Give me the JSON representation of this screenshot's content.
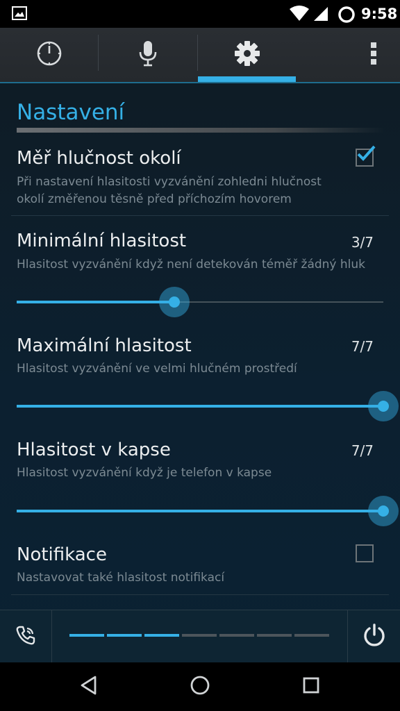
{
  "status_bar": {
    "time": "9:58"
  },
  "tabs": [
    {
      "name": "timer",
      "icon": "clock-icon",
      "selected": false
    },
    {
      "name": "mic",
      "icon": "microphone-icon",
      "selected": false
    },
    {
      "name": "settings",
      "icon": "gear-icon",
      "selected": true
    }
  ],
  "menu_icon": "overflow-menu-icon",
  "colors": {
    "accent": "#35b0e6",
    "background": "#0c2030",
    "title_text": "#eceeef",
    "summary_text": "#7c8a93"
  },
  "settings": {
    "section_title": "Nastavení",
    "measure_noise": {
      "title": "Měř hlučnost okolí",
      "summary": "Při nastavení hlasitosti vyzvánění zohledni hlučnost okolí změřenou těsně před příchozím hovorem",
      "checked": true
    },
    "min_volume": {
      "title": "Minimální hlasitost",
      "summary": "Hlasitost vyzvánění když není detekován téměř žádný hluk",
      "value_label": "3/7",
      "value": 3,
      "max": 7,
      "fraction": 0.43
    },
    "max_volume": {
      "title": "Maximální hlasitost",
      "summary": "Hlasitost vyzvánění ve velmi hlučném prostředí",
      "value_label": "7/7",
      "value": 7,
      "max": 7,
      "fraction": 1.0
    },
    "pocket_volume": {
      "title": "Hlasitost v kapse",
      "summary": "Hlasitost vyzvánění když je telefon v kapse",
      "value_label": "7/7",
      "value": 7,
      "max": 7,
      "fraction": 1.0
    },
    "notifications": {
      "title": "Notifikace",
      "summary": "Nastavovat také hlasitost notifikací",
      "checked": false
    }
  },
  "bottom_bar": {
    "left_icon": "phone-ring-icon",
    "right_icon": "power-icon",
    "level_segments_total": 7,
    "level_segments_on": 3
  },
  "nav_bar": {
    "icons": [
      "back-icon",
      "home-icon",
      "recents-icon"
    ]
  }
}
